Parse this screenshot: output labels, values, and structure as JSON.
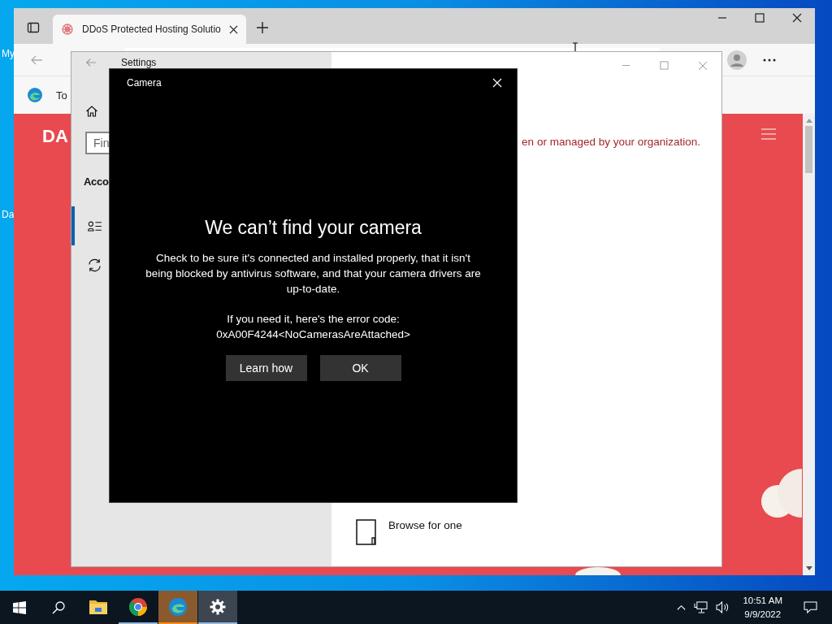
{
  "desktop": {
    "icon_labels": [
      "My",
      "Da"
    ]
  },
  "browser": {
    "tabs": [
      {
        "title": "DDoS Protected Hosting Solutio",
        "selected": true
      }
    ],
    "favorites": [
      "To"
    ],
    "page": {
      "logo_text": "DA"
    }
  },
  "settings": {
    "title": "Settings",
    "search": {
      "placeholder": "Fin"
    },
    "section_heading": "Acco",
    "nav": [
      {
        "kind": "account",
        "selected": true
      },
      {
        "kind": "sync",
        "selected": false
      }
    ],
    "notice": "en or managed by your organization.",
    "browse_label": "Browse for one"
  },
  "dialog": {
    "title": "Camera",
    "heading": "We can’t find your camera",
    "message": "Check to be sure it's connected and installed properly, that it isn't being blocked by antivirus software, and that your camera drivers are up-to-date.",
    "error_label": "If you need it, here's the error code:",
    "error_code": "0xA00F4244<NoCamerasAreAttached>",
    "buttons": [
      "Learn how",
      "OK"
    ]
  },
  "taskbar": {
    "apps": [
      {
        "kind": "explorer",
        "running": false,
        "selected": false,
        "flashing": false
      },
      {
        "kind": "chrome",
        "running": true,
        "selected": false,
        "flashing": false
      },
      {
        "kind": "edge",
        "running": true,
        "selected": false,
        "flashing": true
      },
      {
        "kind": "settings",
        "running": true,
        "selected": true,
        "flashing": false
      }
    ],
    "time": "10:51 AM",
    "date": "9/9/2022"
  }
}
